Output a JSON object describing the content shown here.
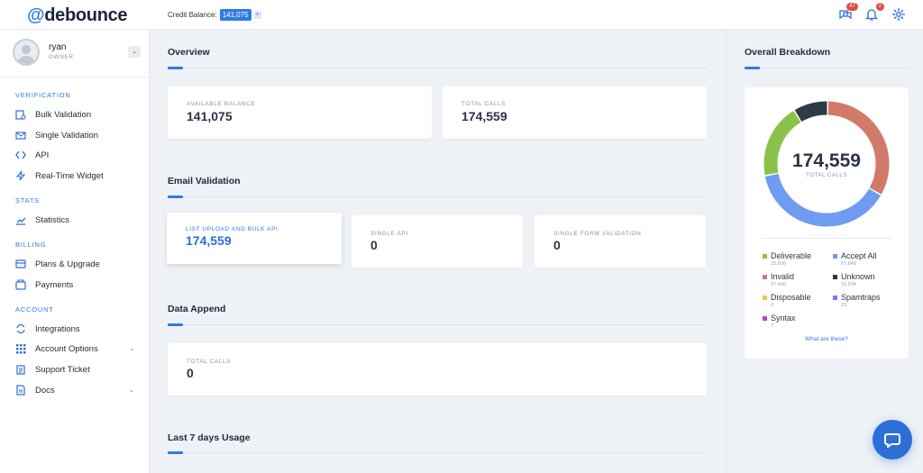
{
  "brand": {
    "at": "@",
    "name": "debounce"
  },
  "topbar": {
    "credit_label": "Credit Balance:",
    "credit_value": "141,075",
    "credit_plus": "+",
    "messages_badge": "47",
    "notifications_badge": "2"
  },
  "user": {
    "name": "ryan",
    "role": "OWNER",
    "caret": "⌄"
  },
  "sidebar": {
    "sections": {
      "verification": "VERIFICATION",
      "stats": "STATS",
      "billing": "BILLING",
      "account": "ACCOUNT"
    },
    "items": {
      "bulk": "Bulk Validation",
      "single": "Single Validation",
      "api": "API",
      "widget": "Real-Time Widget",
      "statistics": "Statistics",
      "plans": "Plans & Upgrade",
      "payments": "Payments",
      "integrations": "Integrations",
      "account_options": "Account Options",
      "support": "Support Ticket",
      "docs": "Docs"
    },
    "chevron": "⌄"
  },
  "overview": {
    "title": "Overview",
    "available_label": "AVAILABLE BALANCE",
    "available_value": "141,075",
    "calls_label": "TOTAL CALLS",
    "calls_value": "174,559"
  },
  "email_validation": {
    "title": "Email Validation",
    "bulk_label": "LIST UPLOAD AND BULK API",
    "bulk_value": "174,559",
    "single_label": "SINGLE API",
    "single_value": "0",
    "form_label": "SINGLE FORM VALIDATION",
    "form_value": "0"
  },
  "data_append": {
    "title": "Data Append",
    "calls_label": "TOTAL CALLS",
    "calls_value": "0"
  },
  "last7": {
    "title": "Last 7 days Usage"
  },
  "breakdown": {
    "title": "Overall Breakdown",
    "total": "174,559",
    "total_label": "TOTAL CALLS",
    "link": "What are these?",
    "legend": [
      {
        "name": "Deliverable",
        "count": "33,806",
        "color": "#8bc34a"
      },
      {
        "name": "Accept All",
        "count": "67,648",
        "color": "#6f9cf0"
      },
      {
        "name": "Invalid",
        "count": "57,440",
        "color": "#d27a6a"
      },
      {
        "name": "Unknown",
        "count": "15,634",
        "color": "#2e3a47"
      },
      {
        "name": "Disposable",
        "count": "2",
        "color": "#f4c542"
      },
      {
        "name": "Spamtraps",
        "count": "23",
        "color": "#8c6ff0"
      },
      {
        "name": "Syntax",
        "count": "7",
        "color": "#c63cc8"
      }
    ]
  },
  "colors": {
    "accent": "#2f7be6"
  }
}
